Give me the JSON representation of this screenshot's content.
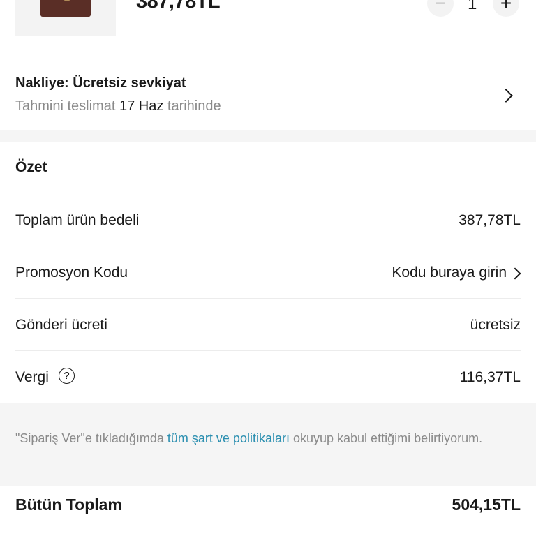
{
  "product": {
    "price": "387,78TL",
    "quantity": "1",
    "minus_symbol": "−",
    "plus_symbol": "+"
  },
  "shipping": {
    "title": "Nakliye: Ücretsiz sevkiyat",
    "sub_prefix": "Tahmini teslimat",
    "sub_date": "17 Haz",
    "sub_suffix": "tarihinde"
  },
  "summary": {
    "title": "Özet",
    "rows": [
      {
        "label": "Toplam ürün bedeli",
        "value": "387,78TL"
      },
      {
        "label": "Promosyon Kodu",
        "value": "Kodu buraya girin"
      },
      {
        "label": "Gönderi ücreti",
        "value": "ücretsiz"
      },
      {
        "label": "Vergi",
        "value": "116,37TL",
        "help_symbol": "?"
      }
    ]
  },
  "terms": {
    "prefix": "\"Sipariş Ver\"e tıkladığımda",
    "link": "tüm şart ve politikaları",
    "suffix": "okuyup kabul ettiğimi belirtiyorum."
  },
  "total": {
    "label": "Bütün Toplam",
    "value": "504,15TL"
  },
  "colors": {
    "link": "#2b8fb0",
    "muted": "#8a8a8a",
    "product_bag": "#5a2e26"
  }
}
